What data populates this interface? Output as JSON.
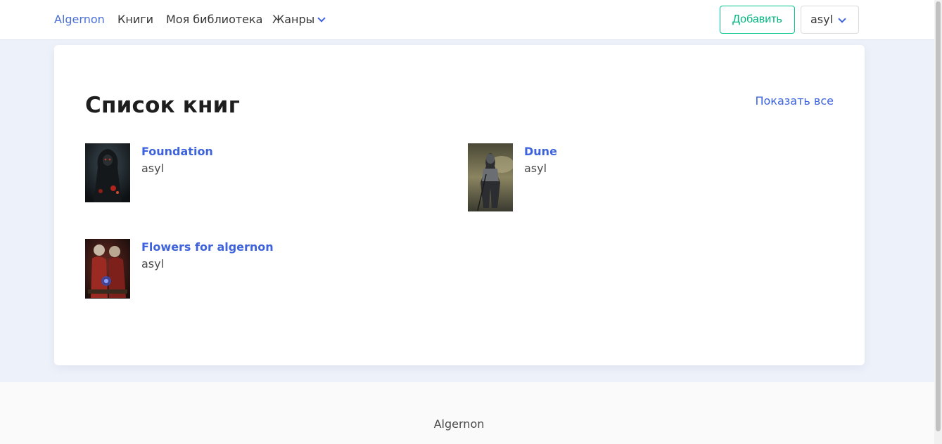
{
  "nav": {
    "brand": "Algernon",
    "books": "Книги",
    "library": "Моя библиотека",
    "genres": "Жанры",
    "add_button": "Добавить",
    "user": "asyl"
  },
  "main": {
    "title": "Список книг",
    "show_all": "Показать все",
    "books": [
      {
        "title": "Foundation",
        "author": "asyl"
      },
      {
        "title": "Dune",
        "author": "asyl"
      },
      {
        "title": "Flowers for algernon",
        "author": "asyl"
      }
    ]
  },
  "footer": {
    "text": "Algernon"
  },
  "colors": {
    "accent": "#3e63dd",
    "add_button": "#00c48c",
    "page_background": "#edf1fa"
  }
}
